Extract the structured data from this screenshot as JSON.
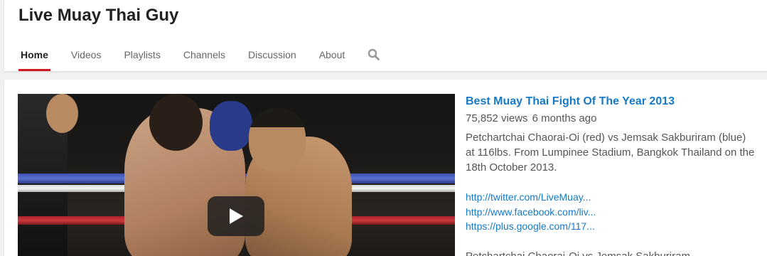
{
  "channel": {
    "title": "Live Muay Thai Guy"
  },
  "nav": {
    "tabs": [
      {
        "label": "Home",
        "active": true
      },
      {
        "label": "Videos"
      },
      {
        "label": "Playlists"
      },
      {
        "label": "Channels"
      },
      {
        "label": "Discussion"
      },
      {
        "label": "About"
      }
    ],
    "search_icon": "search-icon"
  },
  "featured": {
    "title": "Best Muay Thai Fight Of The Year 2013",
    "views": "75,852 views",
    "age": "6 months ago",
    "description": "Petchartchai Chaorai-Oi (red) vs Jemsak Sakburiram (blue) at 116lbs. From Lumpinee Stadium, Bangkok Thailand on the 18th October 2013.",
    "links": [
      "http://twitter.com/LiveMuay...",
      "http://www.facebook.com/liv...",
      "https://plus.google.com/117..."
    ],
    "description_more": "Petchartchai Chaorai-Oi vs Jemsak Sakburiram",
    "play_icon": "play-icon"
  },
  "colors": {
    "accent": "#cc181e",
    "link": "#167ac6"
  }
}
